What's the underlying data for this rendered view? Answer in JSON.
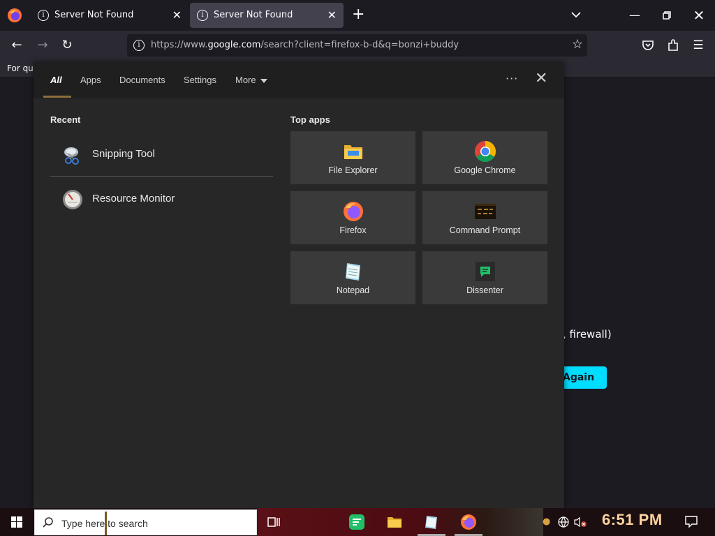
{
  "browser": {
    "tabs": [
      {
        "title": "Server Not Found",
        "active": false
      },
      {
        "title": "Server Not Found",
        "active": true
      }
    ],
    "url_prefix": "https://www.",
    "url_domain": "google.com",
    "url_rest": "/search?client=firefox-b-d&q=bonzi+buddy",
    "bookmarks_text": "For qui",
    "page_partial_text": ", firewall)",
    "page_button_partial": "Again"
  },
  "search_panel": {
    "tabs": [
      {
        "label": "All"
      },
      {
        "label": "Apps"
      },
      {
        "label": "Documents"
      },
      {
        "label": "Settings"
      },
      {
        "label": "More"
      }
    ],
    "recent_heading": "Recent",
    "recent_items": [
      {
        "label": "Snipping Tool",
        "icon": "snipping-tool-icon"
      },
      {
        "label": "Resource Monitor",
        "icon": "resource-monitor-icon"
      }
    ],
    "top_apps_heading": "Top apps",
    "top_apps": [
      {
        "label": "File Explorer",
        "icon": "folder-icon"
      },
      {
        "label": "Google Chrome",
        "icon": "chrome-icon"
      },
      {
        "label": "Firefox",
        "icon": "firefox-icon"
      },
      {
        "label": "Command Prompt",
        "icon": "command-prompt-icon"
      },
      {
        "label": "Notepad",
        "icon": "notepad-icon"
      },
      {
        "label": "Dissenter",
        "icon": "dissenter-icon"
      }
    ]
  },
  "taskbar": {
    "search_placeholder": "Type here to search",
    "clock": "6:51 PM"
  },
  "colors": {
    "panel_bg": "#272727",
    "tile_bg": "#3a3a3a",
    "accent_button": "#00ddff"
  }
}
